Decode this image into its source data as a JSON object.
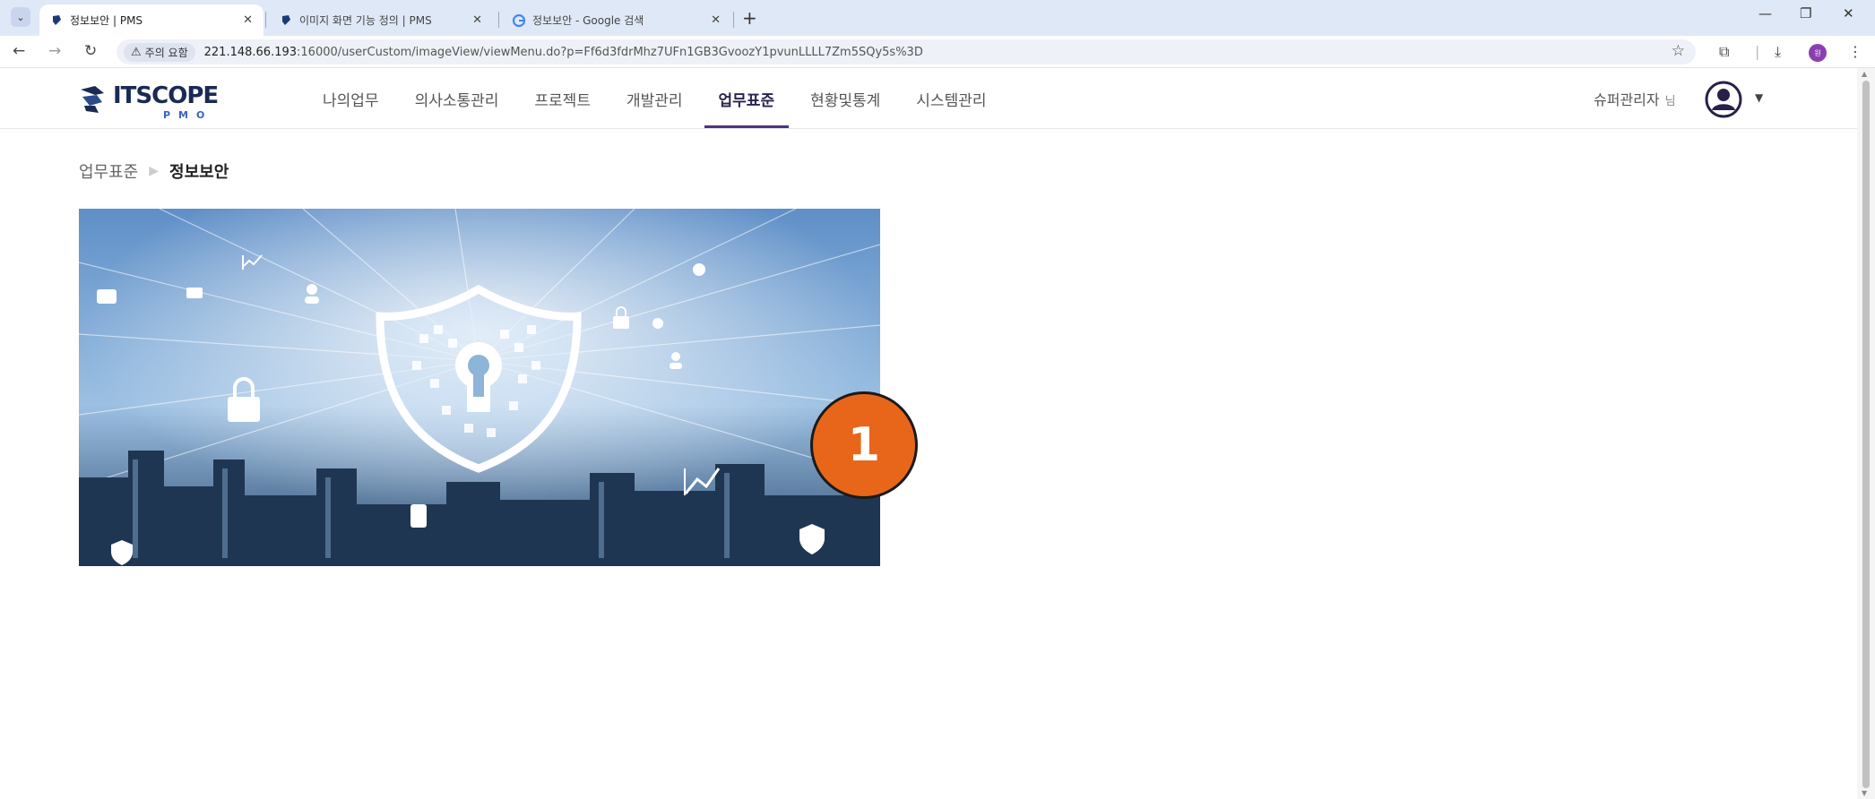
{
  "browser": {
    "tabs": [
      {
        "title": "정보보안 | PMS",
        "active": true
      },
      {
        "title": "이미지 화면 기능 정의 | PMS",
        "active": false
      },
      {
        "title": "정보보안 - Google 검색",
        "active": false
      }
    ],
    "security_chip": "주의 요함",
    "url_host": "221.148.66.193",
    "url_rest": ":16000/userCustom/imageView/viewMenu.do?p=Ff6d3fdrMhz7UFn1GB3GvoozY1pvunLLLL7Zm5SQy5s%3D",
    "profile_initial": "원"
  },
  "header": {
    "logo_text": "ITSCOPE",
    "logo_sub": "PMO",
    "nav": [
      {
        "label": "나의업무",
        "active": false
      },
      {
        "label": "의사소통관리",
        "active": false
      },
      {
        "label": "프로젝트",
        "active": false
      },
      {
        "label": "개발관리",
        "active": false
      },
      {
        "label": "업무표준",
        "active": true
      },
      {
        "label": "현황및통계",
        "active": false
      },
      {
        "label": "시스템관리",
        "active": false
      }
    ],
    "user_name": "슈퍼관리자",
    "user_suffix": "님"
  },
  "breadcrumb": {
    "parent": "업무표준",
    "current": "정보보안"
  },
  "step_marker": "1",
  "colors": {
    "accent": "#4a3580",
    "badge": "#e8661a"
  }
}
